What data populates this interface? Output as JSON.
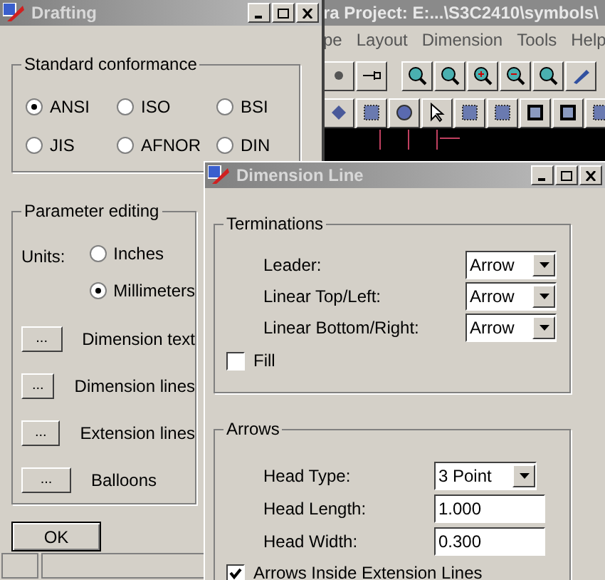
{
  "background_window": {
    "title": "ra  Project: E:...\\S3C2410\\symbols\\",
    "menu": [
      "pe",
      "Layout",
      "Dimension",
      "Tools",
      "Help"
    ]
  },
  "drafting": {
    "title": "Drafting",
    "standard_conformance": {
      "title": "Standard conformance",
      "options": [
        {
          "label": "ANSI",
          "selected": true
        },
        {
          "label": "ISO",
          "selected": false
        },
        {
          "label": "BSI",
          "selected": false
        },
        {
          "label": "JIS",
          "selected": false
        },
        {
          "label": "AFNOR",
          "selected": false
        },
        {
          "label": "DIN",
          "selected": false
        }
      ]
    },
    "parameter_editing": {
      "title": "Parameter editing",
      "units_label": "Units:",
      "units": [
        {
          "label": "Inches",
          "selected": false
        },
        {
          "label": "Millimeters",
          "selected": true
        }
      ],
      "items": [
        {
          "button": "...",
          "label": "Dimension text"
        },
        {
          "button": "...",
          "label": "Dimension lines"
        },
        {
          "button": "...",
          "label": "Extension lines"
        },
        {
          "button": "...",
          "label": "Balloons"
        }
      ]
    },
    "ok_button": "OK"
  },
  "dimension_line": {
    "title": "Dimension Line",
    "terminations": {
      "title": "Terminations",
      "rows": [
        {
          "label": "Leader:",
          "value": "Arrow"
        },
        {
          "label": "Linear Top/Left:",
          "value": "Arrow"
        },
        {
          "label": "Linear Bottom/Right:",
          "value": "Arrow"
        }
      ],
      "fill": {
        "label": "Fill",
        "checked": false
      }
    },
    "arrows": {
      "title": "Arrows",
      "rows": [
        {
          "kind": "select",
          "label": "Head Type:",
          "value": "3 Point"
        },
        {
          "kind": "input",
          "label": "Head Length:",
          "value": "1.000"
        },
        {
          "kind": "input",
          "label": "Head Width:",
          "value": "0.300"
        }
      ],
      "inside": {
        "label": "Arrows Inside Extension Lines",
        "checked": true
      }
    }
  }
}
